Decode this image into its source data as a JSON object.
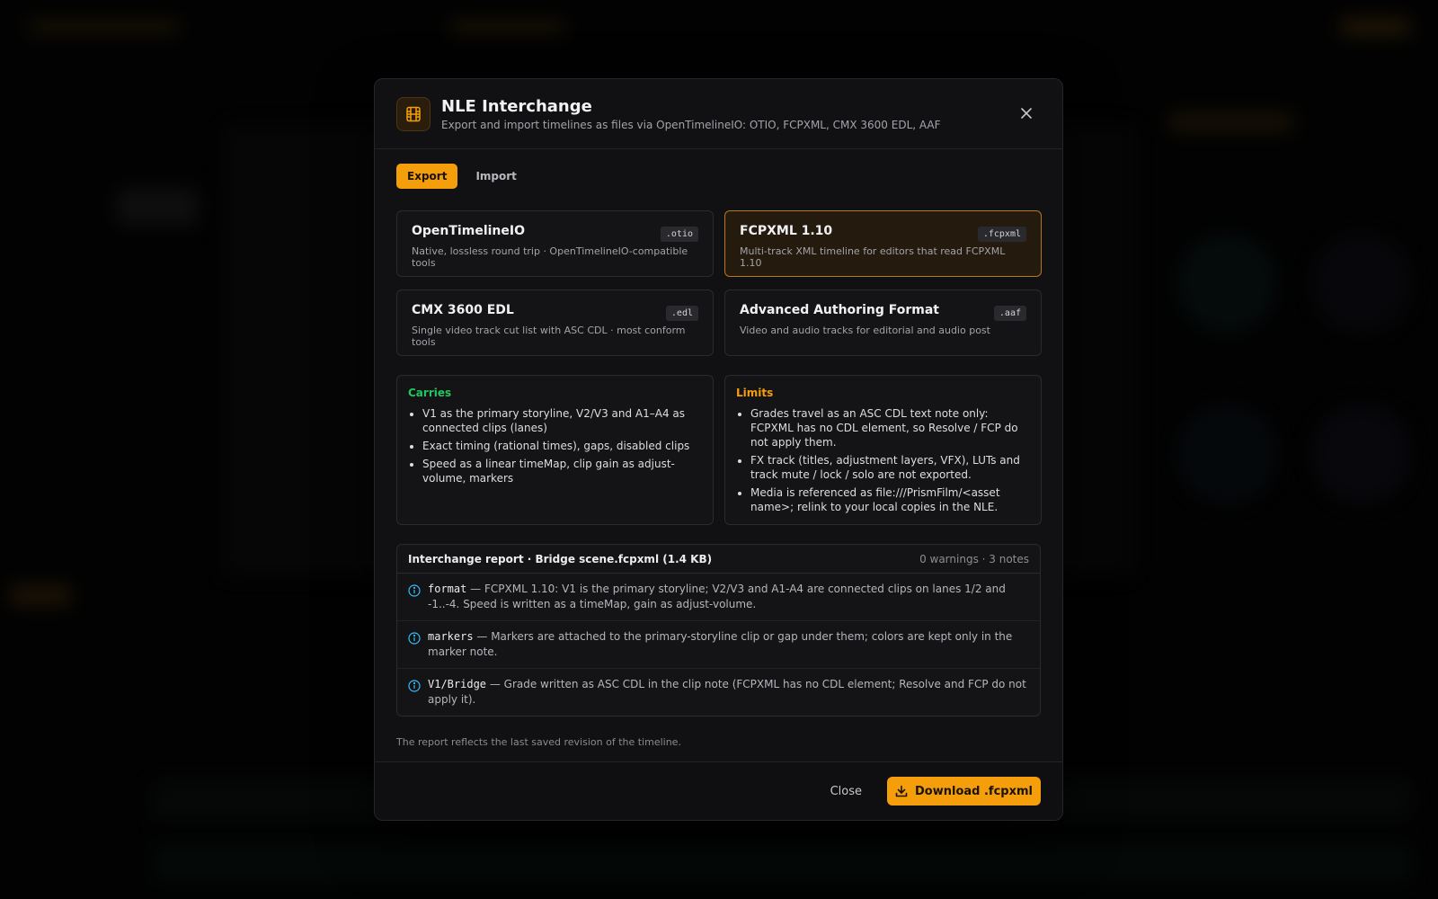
{
  "modal": {
    "title": "NLE Interchange",
    "subtitle": "Export and import timelines as files via OpenTimelineIO: OTIO, FCPXML, CMX 3600 EDL, AAF"
  },
  "tabs": [
    {
      "label": "Export",
      "active": true
    },
    {
      "label": "Import",
      "active": false
    }
  ],
  "formats": [
    {
      "name": "OpenTimelineIO",
      "ext": ".otio",
      "desc": "Native, lossless round trip · OpenTimelineIO-compatible tools",
      "selected": false
    },
    {
      "name": "FCPXML 1.10",
      "ext": ".fcpxml",
      "desc": "Multi-track XML timeline for editors that read FCPXML 1.10",
      "selected": true
    },
    {
      "name": "CMX 3600 EDL",
      "ext": ".edl",
      "desc": "Single video track cut list with ASC CDL · most conform tools",
      "selected": false
    },
    {
      "name": "Advanced Authoring Format",
      "ext": ".aaf",
      "desc": "Video and audio tracks for editorial and audio post",
      "selected": false
    }
  ],
  "carries": {
    "title": "Carries",
    "items": [
      "V1 as the primary storyline, V2/V3 and A1–A4 as connected clips (lanes)",
      "Exact timing (rational times), gaps, disabled clips",
      "Speed as a linear timeMap, clip gain as adjust-volume, markers"
    ]
  },
  "limits": {
    "title": "Limits",
    "items": [
      "Grades travel as an ASC CDL text note only: FCPXML has no CDL element, so Resolve / FCP do not apply them.",
      "FX track (titles, adjustment layers, VFX), LUTs and track mute / lock / solo are not exported.",
      "Media is referenced as file:///PrismFilm/<asset name>; relink to your local copies in the NLE."
    ]
  },
  "report": {
    "title": "Interchange report · Bridge scene.fcpxml (1.4 KB)",
    "counts": "0 warnings · 3 notes",
    "notes": [
      {
        "key": "format",
        "text": " — FCPXML 1.10: V1 is the primary storyline; V2/V3 and A1-A4 are connected clips on lanes 1/2 and -1..-4. Speed is written as a timeMap, gain as adjust-volume."
      },
      {
        "key": "markers",
        "text": " — Markers are attached to the primary-storyline clip or gap under them; colors are kept only in the marker note."
      },
      {
        "key": "V1/Bridge",
        "text": " — Grade written as ASC CDL in the clip note (FCPXML has no CDL element; Resolve and FCP do not apply it)."
      }
    ]
  },
  "footnote": "The report reflects the last saved revision of the timeline.",
  "footer": {
    "close_label": "Close",
    "download_label": "Download .fcpxml"
  },
  "colors": {
    "accent": "#f59e0b",
    "carries": "#22c55e",
    "info": "#38bdf8"
  }
}
